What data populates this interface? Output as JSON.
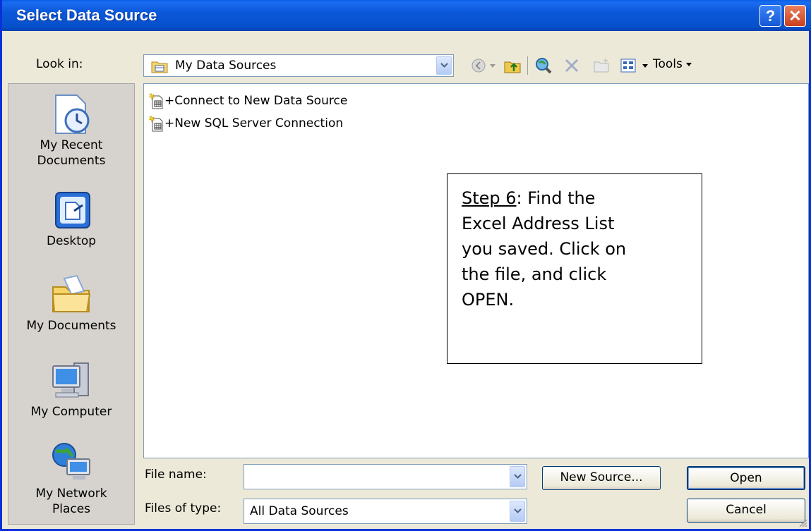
{
  "window": {
    "title": "Select Data Source",
    "help_label": "?",
    "close_label": "✕"
  },
  "look_in": {
    "label": "Look in:",
    "value": "My Data Sources"
  },
  "toolbar": {
    "icons": [
      "back-icon",
      "up-folder-icon",
      "search-web-icon",
      "delete-icon",
      "new-folder-icon",
      "views-icon"
    ],
    "tools_label": "Tools"
  },
  "places": [
    {
      "name": "recent",
      "label_line1": "My Recent",
      "label_line2": "Documents"
    },
    {
      "name": "desktop",
      "label_line1": "Desktop",
      "label_line2": ""
    },
    {
      "name": "documents",
      "label_line1": "My Documents",
      "label_line2": ""
    },
    {
      "name": "computer",
      "label_line1": "My Computer",
      "label_line2": ""
    },
    {
      "name": "network",
      "label_line1": "My Network",
      "label_line2": "Places"
    }
  ],
  "files": [
    {
      "label": "+Connect to New Data Source"
    },
    {
      "label": "+New SQL Server Connection"
    }
  ],
  "callout": {
    "step": "Step 6",
    "rest_line1": ":  Find the",
    "line2": "Excel Address List",
    "line3": "you saved.   Click on",
    "line4": "the file, and click",
    "line5": "OPEN."
  },
  "file_name": {
    "label": "File name:",
    "value": ""
  },
  "file_type": {
    "label": "Files of type:",
    "value": "All Data Sources"
  },
  "buttons": {
    "new_source": "New Source...",
    "open": "Open",
    "cancel": "Cancel"
  },
  "colors": {
    "titlebar": "#0650cc",
    "dialog_bg": "#ece9d8",
    "accent": "#0831d9"
  }
}
